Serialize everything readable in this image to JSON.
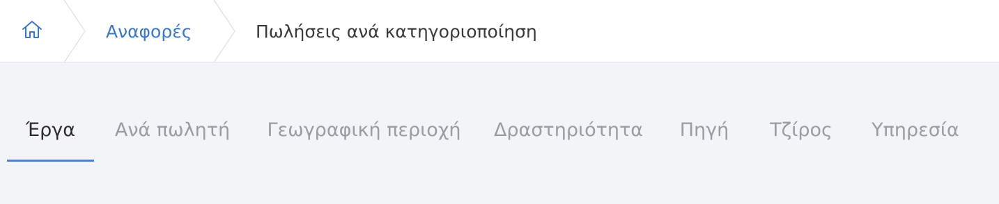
{
  "breadcrumb": {
    "home_icon": "home-icon",
    "reports_label": "Αναφορές",
    "current_label": "Πωλήσεις ανά κατηγοριοποίηση"
  },
  "tabs": [
    {
      "label": "Έργα",
      "active": true
    },
    {
      "label": "Ανά πωλητή",
      "active": false
    },
    {
      "label": "Γεωγραφική περιοχή",
      "active": false
    },
    {
      "label": "Δραστηριότητα",
      "active": false
    },
    {
      "label": "Πηγή",
      "active": false
    },
    {
      "label": "Τζίρος",
      "active": false
    },
    {
      "label": "Υπηρεσία",
      "active": false
    }
  ],
  "colors": {
    "accent": "#4a84cf",
    "link": "#3b78c4",
    "inactive_tab": "#9a9ca1",
    "background": "#f3f4f7"
  }
}
